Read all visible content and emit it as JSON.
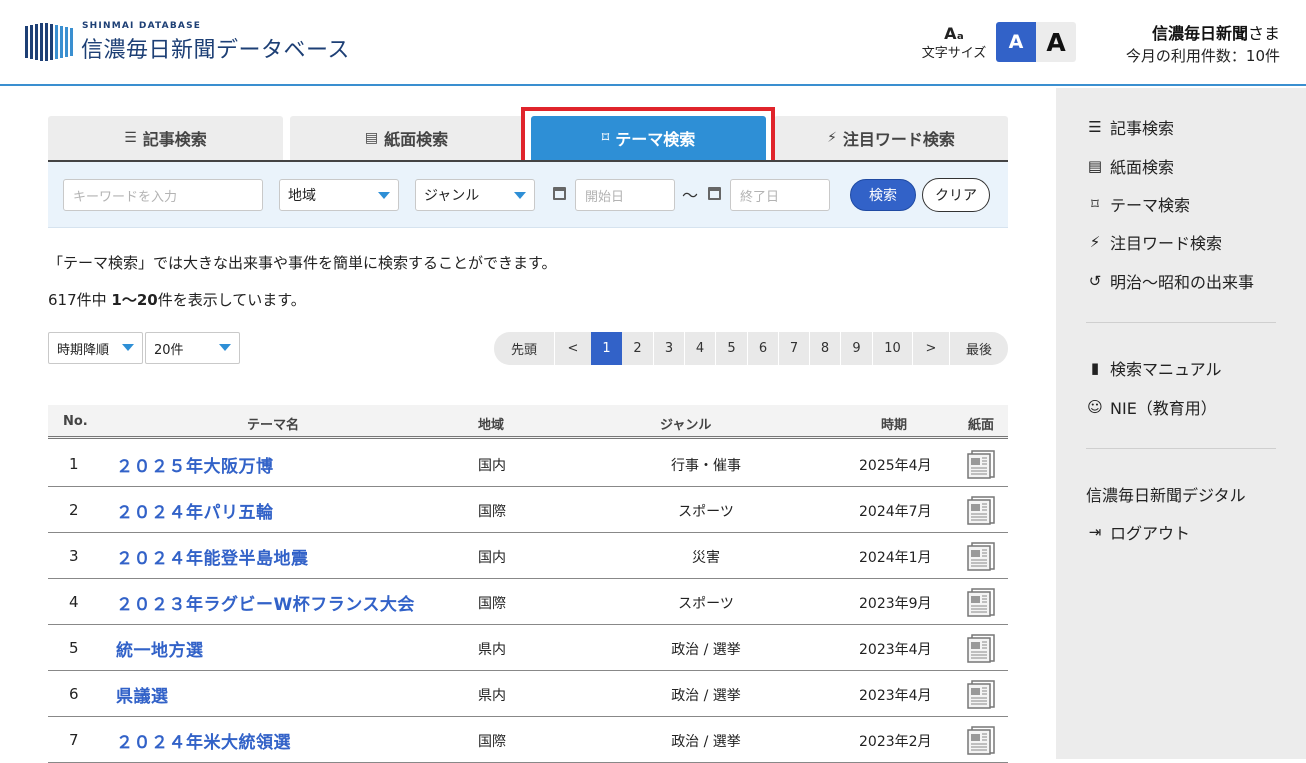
{
  "header": {
    "logo_sub": "SHINMAI DATABASE",
    "logo_title": "信濃毎日新聞データベース",
    "font_size_label": "文字サイズ",
    "font_size_small": "A",
    "font_size_large": "A",
    "user_name": "信濃毎日新聞",
    "user_suffix": "さま",
    "usage": "今月の利用件数：10件"
  },
  "tabs": [
    {
      "label": "記事検索",
      "icon": "list-icon",
      "active": false
    },
    {
      "label": "紙面検索",
      "icon": "newspaper-icon",
      "active": false
    },
    {
      "label": "テーマ検索",
      "icon": "bookmark-icon",
      "active": true
    },
    {
      "label": "注目ワード検索",
      "icon": "bolt-icon",
      "active": false
    }
  ],
  "search": {
    "keyword_placeholder": "キーワードを入力",
    "region": "地域",
    "genre": "ジャンル",
    "start_placeholder": "開始日",
    "tilde": "〜",
    "end_placeholder": "終了日",
    "search_label": "検索",
    "clear_label": "クリア"
  },
  "intro": "「テーマ検索」では大きな出来事や事件を簡単に検索することができます。",
  "count": {
    "prefix": "617件中 ",
    "range": "1〜20",
    "suffix": "件を表示しています。"
  },
  "sort": {
    "order": "時期降順",
    "per_page": "20件"
  },
  "pager": {
    "first": "先頭",
    "prev": "<",
    "pages": [
      "1",
      "2",
      "3",
      "4",
      "5",
      "6",
      "7",
      "8",
      "9",
      "10"
    ],
    "current": "1",
    "next": ">",
    "last": "最後"
  },
  "table": {
    "headers": {
      "no": "No.",
      "theme": "テーマ名",
      "region": "地域",
      "genre": "ジャンル",
      "period": "時期",
      "paper": "紙面"
    },
    "rows": [
      {
        "no": "1",
        "theme": "２０２５年大阪万博",
        "region": "国内",
        "genre": "行事・催事",
        "period": "2025年4月"
      },
      {
        "no": "2",
        "theme": "２０２４年パリ五輪",
        "region": "国際",
        "genre": "スポーツ",
        "period": "2024年7月"
      },
      {
        "no": "3",
        "theme": "２０２４年能登半島地震",
        "region": "国内",
        "genre": "災害",
        "period": "2024年1月"
      },
      {
        "no": "4",
        "theme": "２０２３年ラグビーW杯フランス大会",
        "region": "国際",
        "genre": "スポーツ",
        "period": "2023年9月"
      },
      {
        "no": "5",
        "theme": "統一地方選",
        "region": "県内",
        "genre": "政治 / 選挙",
        "period": "2023年4月"
      },
      {
        "no": "6",
        "theme": "県議選",
        "region": "県内",
        "genre": "政治 / 選挙",
        "period": "2023年4月"
      },
      {
        "no": "7",
        "theme": "２０２４年米大統領選",
        "region": "国際",
        "genre": "政治 / 選挙",
        "period": "2023年2月"
      }
    ]
  },
  "sidebar": {
    "items": [
      {
        "label": "記事検索",
        "icon": "list-icon"
      },
      {
        "label": "紙面検索",
        "icon": "newspaper-icon"
      },
      {
        "label": "テーマ検索",
        "icon": "bookmark-icon"
      },
      {
        "label": "注目ワード検索",
        "icon": "bolt-icon"
      },
      {
        "label": "明治〜昭和の出来事",
        "icon": "history-icon"
      }
    ],
    "manual": "検索マニュアル",
    "nie": "NIE（教育用）",
    "digital": "信濃毎日新聞デジタル",
    "logout": "ログアウト"
  },
  "colors": {
    "accent": "#2e8fd6",
    "primary": "#3262c8",
    "highlight": "#e0242b",
    "logo": "#1d3f75"
  }
}
